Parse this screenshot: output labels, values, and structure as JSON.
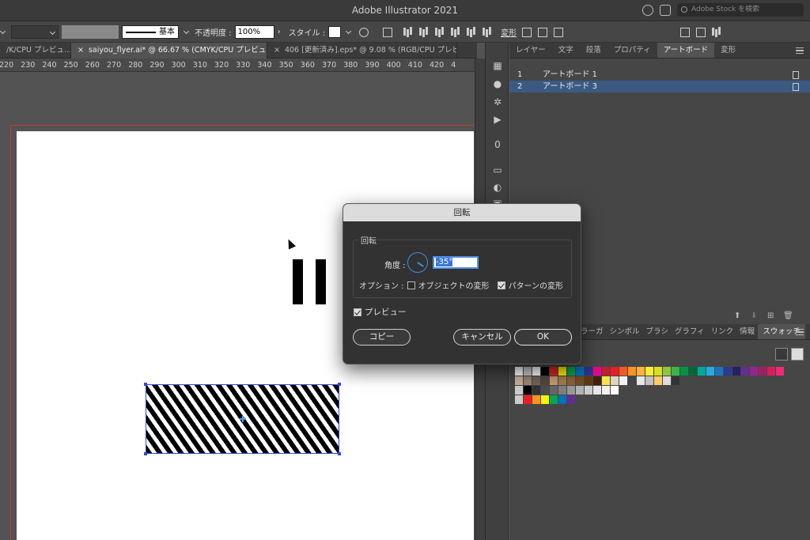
{
  "window": {
    "title": "Adobe Illustrator 2021",
    "search_placeholder": "Adobe Stock を検索"
  },
  "control_bar": {
    "stroke_style": "基本",
    "opacity_label": "不透明度 :",
    "opacity_value": "100%",
    "style_label": "スタイル :",
    "transform_label": "変形"
  },
  "doc_tabs": [
    {
      "label": "/K/CPU プレビュ…",
      "active": false
    },
    {
      "label": "saiyou_flyer.ai* @ 66.67 % (CMYK/CPU プレビュー)",
      "active": true
    },
    {
      "label": "406 [更新済み].eps* @ 9.08 % (RGB/CPU プレビ…",
      "active": false
    }
  ],
  "ruler_ticks": [
    "220",
    "230",
    "240",
    "250",
    "260",
    "270",
    "280",
    "290",
    "300",
    "310",
    "320",
    "330",
    "340",
    "350",
    "360",
    "370",
    "380",
    "390",
    "400",
    "410",
    "420",
    "4"
  ],
  "panel": {
    "tabs": [
      "レイヤー",
      "文字",
      "段落",
      "プロパティ",
      "アートボード",
      "変形"
    ],
    "active_tab": "アートボード",
    "artboards": [
      {
        "num": "1",
        "name": "アートボード 1",
        "selected": false
      },
      {
        "num": "2",
        "name": "アートボード 3",
        "selected": true
      }
    ]
  },
  "swatch_panel": {
    "tabs": [
      "ラーガ",
      "シンボル",
      "ブラシ",
      "グラフィ",
      "リンク",
      "情報",
      "スウォッチ"
    ],
    "active_tab": "スウォッチ",
    "rows": [
      [
        "#ffffff",
        "#c8c8c8",
        "#ffffff",
        "#000000",
        "#e2231a",
        "#fff200",
        "#00a651",
        "#0072bc",
        "#2e3192",
        "#ec008c",
        "#be1e2d",
        "#ed1c24",
        "#f15a24",
        "#f7941d",
        "#fbb040",
        "#f9ed32",
        "#d7df23",
        "#8dc63f",
        "#39b54a",
        "#009444",
        "#006838",
        "#00a79d",
        "#27aae1",
        "#1c75bc",
        "#2b3990",
        "#262262",
        "#662d91",
        "#92278f",
        "#9e1f63",
        "#da1c5c",
        "#ee2a7b"
      ],
      [
        "#c7b299",
        "#998675",
        "#736357",
        "#534741",
        "#c69c6d",
        "#a67c52",
        "#8c6239",
        "#754c24",
        "#603813",
        "#42210b",
        "#f7e44a",
        "#e0d4c4",
        "#f2f2f2",
        "#444444",
        "#e6e6e6",
        "#c0c0c0",
        "#ffcc66",
        "#dddddd",
        "#333333"
      ],
      [
        "#cccccc",
        "#000000",
        "#333333",
        "#4d4d4d",
        "#666666",
        "#808080",
        "#999999",
        "#b3b3b3",
        "#cccccc",
        "#e6e6e6",
        "#f2f2f2",
        "#ffffff"
      ],
      [
        "#cccccc",
        "#ed1c24",
        "#f7941d",
        "#fff200",
        "#00a651",
        "#0072bc",
        "#662d91"
      ]
    ]
  },
  "dialog": {
    "title": "回転",
    "group_label": "回転",
    "angle_label": "角度 :",
    "angle_value": "-35°",
    "options_label": "オプション :",
    "opt_object": "オブジェクトの変形",
    "opt_object_checked": false,
    "opt_pattern": "パターンの変形",
    "opt_pattern_checked": true,
    "preview": "プレビュー",
    "preview_checked": true,
    "copy": "コピー",
    "cancel": "キャンセル",
    "ok": "OK"
  }
}
